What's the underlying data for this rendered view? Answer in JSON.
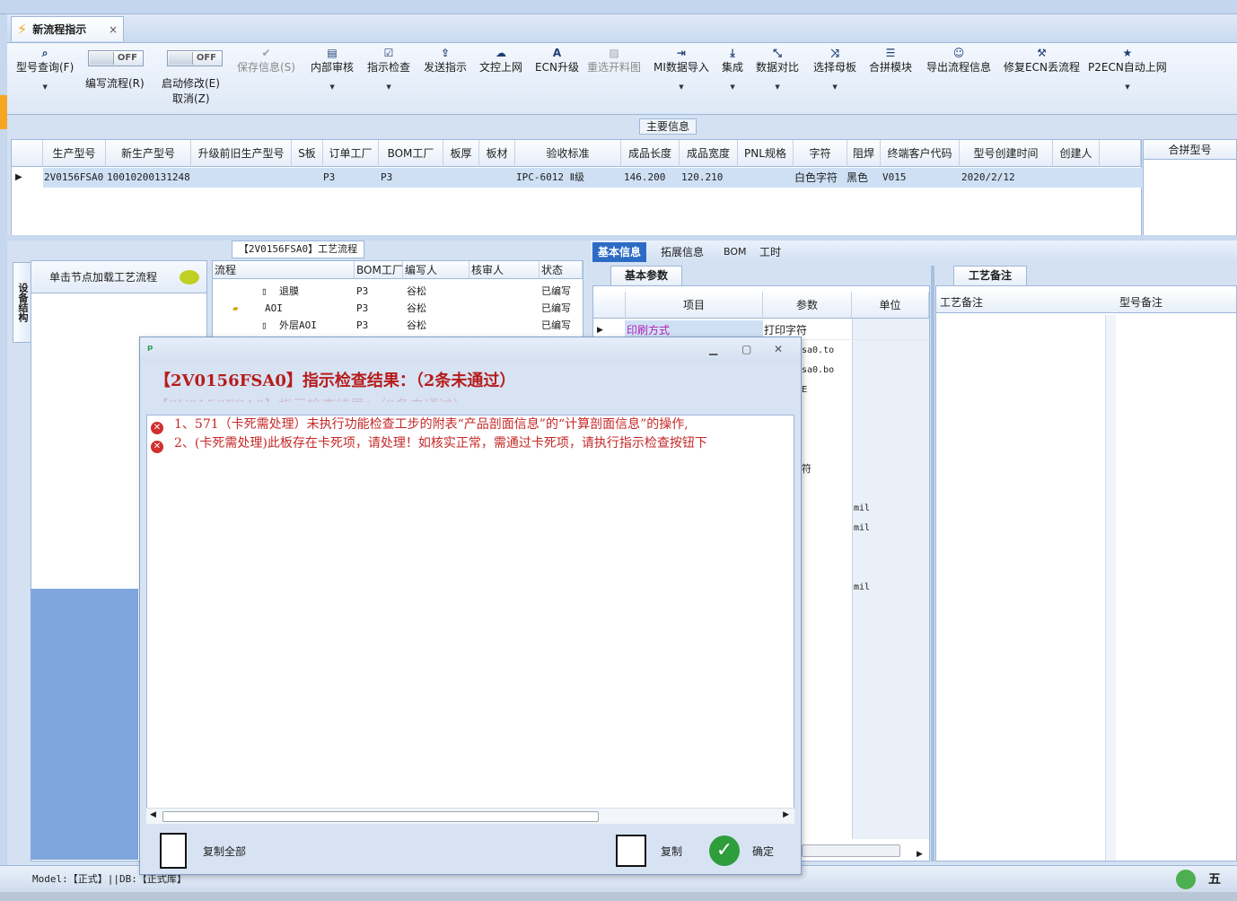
{
  "tab": {
    "title": "新流程指示",
    "close": "×"
  },
  "toolbar": {
    "model_query": "型号查询(F)",
    "write_flow": "编写流程(R)",
    "toggle_off": "OFF",
    "start_modify": "启动修改(E)",
    "cancel": "取消(Z)",
    "save_info": "保存信息(S)",
    "internal_review": "内部审核",
    "instruction_check": "指示检查",
    "send_instruction": "发送指示",
    "doc_upload": "文控上网",
    "ecn_upgrade": "ECN升级",
    "reselect_map": "重选开料图",
    "mi_import": "MI数据导入",
    "integrate": "集成",
    "data_compare": "数据对比",
    "select_parent": "选择母板",
    "merge_module": "合拼模块",
    "export_flow": "导出流程信息",
    "repair_ecn": "修复ECN丢流程",
    "p2ecn_upload": "P2ECN自动上网"
  },
  "main_info": {
    "title": "主要信息",
    "columns": [
      "生产型号",
      "新生产型号",
      "升级前旧生产型号",
      "S板",
      "订单工厂",
      "BOM工厂",
      "板厚",
      "板材",
      "验收标准",
      "成品长度",
      "成品宽度",
      "PNL规格",
      "字符",
      "阻焊",
      "终端客户代码",
      "型号创建时间",
      "创建人"
    ],
    "row": {
      "prod_model": "2V0156FSA0",
      "new_model": "10010200131248",
      "order_factory": "P3",
      "bom_factory": "P3",
      "standard": "IPC-6012 Ⅱ级",
      "length": "146.200",
      "width": "120.210",
      "char": "白色字符",
      "solder": "黑色",
      "customer": "V015",
      "created": "2020/2/12"
    },
    "merge_header": "合拼型号"
  },
  "left_panel": {
    "vertical_tab": "设备结构",
    "hint": "单击节点加载工艺流程"
  },
  "process": {
    "title": "【2V0156FSA0】工艺流程",
    "columns": [
      "流程",
      "BOM工厂",
      "编写人",
      "核审人",
      "状态"
    ],
    "rows": [
      {
        "name": "退膜",
        "bom": "P3",
        "writer": "谷松",
        "state": "已编写"
      },
      {
        "name": "AOI",
        "bom": "P3",
        "writer": "谷松",
        "state": "已编写"
      },
      {
        "name": "外层AOI",
        "bom": "P3",
        "writer": "谷松",
        "state": "已编写"
      }
    ]
  },
  "right_tabs": [
    "基本信息",
    "拓展信息",
    "BOM",
    "工时"
  ],
  "params": {
    "subtab": "基本参数",
    "columns": [
      "项目",
      "参数",
      "单位"
    ],
    "row1": {
      "item": "印刷方式",
      "value": "打印字符"
    },
    "fragments": [
      "sa0.to",
      "sa0.bo",
      "E",
      "符"
    ],
    "units": [
      "mil",
      "mil",
      "mil"
    ]
  },
  "notes": {
    "subtab": "工艺备注",
    "col1": "工艺备注",
    "col2": "型号备注"
  },
  "dialog": {
    "title": "【2V0156FSA0】指示检查结果：（2条未通过）",
    "messages": [
      "1、571（卡死需处理）未执行功能检查工步的附表“产品剖面信息”的“计算剖面信息”的操作,",
      "2、(卡死需处理)此板存在卡死项，请处理！如核实正常，需通过卡死项，请执行指示检查按钮下"
    ],
    "copy_all": "复制全部",
    "copy": "复制",
    "ok": "确定"
  },
  "status": {
    "text": "Model:【正式】||DB:【正式库】"
  },
  "ime": {
    "label": "五"
  }
}
